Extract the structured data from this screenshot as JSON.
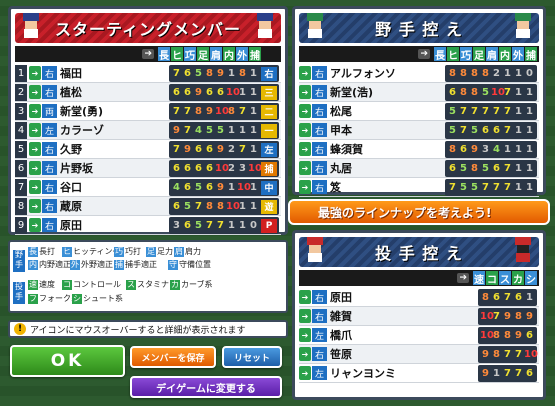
{
  "lineup": {
    "title": "スターティングメンバー",
    "col_headers": [
      "長",
      "ヒ",
      "巧",
      "足",
      "肩",
      "内",
      "外",
      "捕"
    ],
    "players": [
      {
        "num": "1",
        "hand": "右",
        "name": "福田",
        "stats": [
          "7",
          "6",
          "5",
          "8",
          "9",
          "1",
          "8",
          "1"
        ],
        "pos": "右",
        "pos_color": "#1e6fc2"
      },
      {
        "num": "2",
        "hand": "右",
        "name": "植松",
        "stats": [
          "6",
          "6",
          "9",
          "6",
          "6",
          "10",
          "1",
          "1"
        ],
        "pos": "三",
        "pos_color": "#e6b800"
      },
      {
        "num": "3",
        "hand": "両",
        "name": "新堂(勇)",
        "stats": [
          "7",
          "7",
          "8",
          "9",
          "10",
          "8",
          "7",
          "1"
        ],
        "pos": "二",
        "pos_color": "#e6b800"
      },
      {
        "num": "4",
        "hand": "左",
        "name": "カラーゾ",
        "stats": [
          "9",
          "7",
          "4",
          "5",
          "5",
          "1",
          "1",
          "1"
        ],
        "pos": "一",
        "pos_color": "#e6b800"
      },
      {
        "num": "5",
        "hand": "右",
        "name": "久野",
        "stats": [
          "7",
          "9",
          "6",
          "6",
          "9",
          "2",
          "7",
          "1"
        ],
        "pos": "左",
        "pos_color": "#1e6fc2"
      },
      {
        "num": "6",
        "hand": "右",
        "name": "片野坂",
        "stats": [
          "6",
          "6",
          "6",
          "6",
          "10",
          "2",
          "3",
          "10"
        ],
        "pos": "捕",
        "pos_color": "#e07800"
      },
      {
        "num": "7",
        "hand": "右",
        "name": "谷口",
        "stats": [
          "4",
          "6",
          "5",
          "6",
          "9",
          "1",
          "10",
          "1"
        ],
        "pos": "中",
        "pos_color": "#1e6fc2"
      },
      {
        "num": "8",
        "hand": "右",
        "name": "蔵原",
        "stats": [
          "6",
          "5",
          "7",
          "8",
          "8",
          "10",
          "1",
          "1"
        ],
        "pos": "遊",
        "pos_color": "#e6b800"
      },
      {
        "num": "9",
        "hand": "右",
        "name": "原田",
        "stats": [
          "3",
          "6",
          "5",
          "7",
          "7",
          "1",
          "1",
          "0"
        ],
        "pos": "P",
        "pos_color": "#d22020"
      }
    ]
  },
  "fielders": {
    "title": "野 手 控 え",
    "col_headers": [
      "長",
      "ヒ",
      "巧",
      "足",
      "肩",
      "内",
      "外",
      "捕"
    ],
    "players": [
      {
        "hand": "右",
        "name": "アルフォンソ",
        "stats": [
          "8",
          "8",
          "8",
          "8",
          "2",
          "1",
          "1",
          "0"
        ]
      },
      {
        "hand": "右",
        "name": "新堂(浩)",
        "stats": [
          "6",
          "8",
          "8",
          "5",
          "10",
          "7",
          "1",
          "1"
        ]
      },
      {
        "hand": "右",
        "name": "松尾",
        "stats": [
          "5",
          "7",
          "7",
          "7",
          "7",
          "7",
          "1",
          "1"
        ]
      },
      {
        "hand": "右",
        "name": "甲本",
        "stats": [
          "5",
          "7",
          "5",
          "6",
          "6",
          "7",
          "1",
          "1"
        ]
      },
      {
        "hand": "右",
        "name": "蜂須賀",
        "stats": [
          "8",
          "6",
          "9",
          "3",
          "4",
          "1",
          "1",
          "1"
        ]
      },
      {
        "hand": "右",
        "name": "丸居",
        "stats": [
          "6",
          "5",
          "8",
          "5",
          "6",
          "7",
          "1",
          "1"
        ]
      },
      {
        "hand": "右",
        "name": "笈",
        "stats": [
          "7",
          "5",
          "5",
          "7",
          "7",
          "7",
          "1",
          "1"
        ]
      }
    ]
  },
  "promo_text": "最強のラインナップを考えよう!",
  "pitchers": {
    "title": "投 手 控 え",
    "col_headers": [
      "速",
      "コ",
      "ス",
      "カ",
      "シ"
    ],
    "players": [
      {
        "hand": "右",
        "name": "原田",
        "stats": [
          "8",
          "6",
          "7",
          "6",
          "1"
        ]
      },
      {
        "hand": "右",
        "name": "雑賀",
        "stats": [
          "10",
          "7",
          "9",
          "8",
          "9"
        ]
      },
      {
        "hand": "左",
        "name": "橋爪",
        "stats": [
          "10",
          "8",
          "8",
          "9",
          "6"
        ]
      },
      {
        "hand": "右",
        "name": "笹原",
        "stats": [
          "9",
          "8",
          "7",
          "7",
          "10"
        ]
      },
      {
        "hand": "左",
        "name": "リャンヨンミ",
        "stats": [
          "9",
          "1",
          "7",
          "7",
          "6"
        ]
      }
    ]
  },
  "legend": {
    "fielder_label": "野手",
    "pitcher_label": "投手",
    "fielder_items": [
      [
        "長",
        "長打"
      ],
      [
        "ヒ",
        "ヒッティング"
      ],
      [
        "巧",
        "巧打"
      ],
      [
        "足",
        "足力"
      ],
      [
        "肩",
        "肩力"
      ],
      [
        "内",
        "内野適正"
      ],
      [
        "外",
        "外野適正"
      ],
      [
        "捕",
        "捕手適正"
      ],
      [
        "守",
        "守備位置"
      ]
    ],
    "pitcher_items": [
      [
        "速",
        "速度"
      ],
      [
        "コ",
        "コントロール"
      ],
      [
        "ス",
        "スタミナ"
      ],
      [
        "カ",
        "カーブ系"
      ],
      [
        "フ",
        "フォーク系"
      ],
      [
        "シ",
        "シュート系"
      ]
    ]
  },
  "info_text": "アイコンにマウスオーバーすると詳細が表示されます",
  "buttons": {
    "ok": "OK",
    "save": "メンバーを保存",
    "reset": "リセット",
    "day": "デイゲームに変更する"
  }
}
